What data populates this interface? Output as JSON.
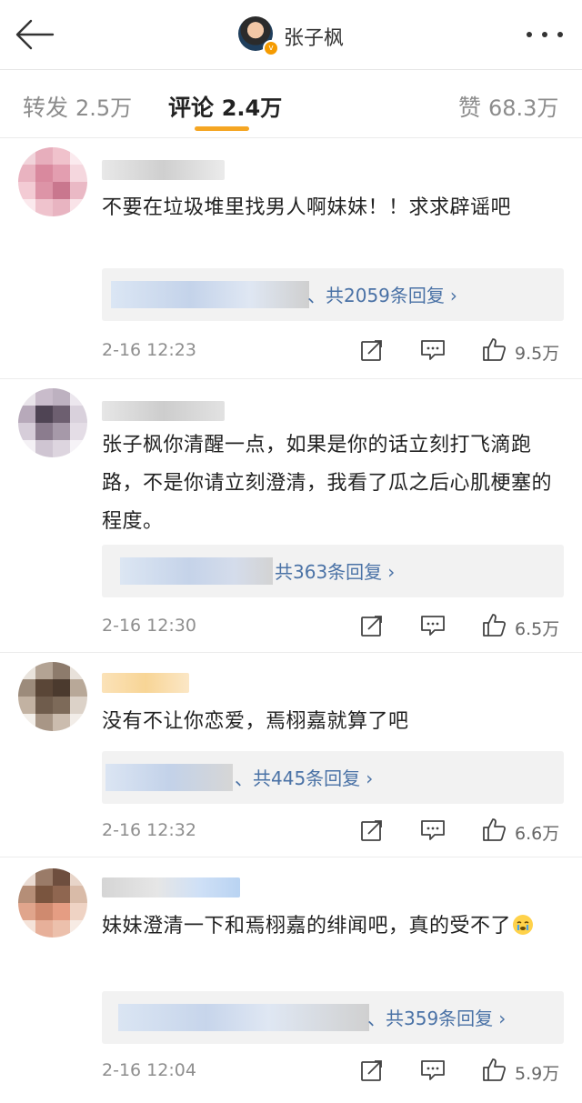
{
  "header": {
    "user_name": "张子枫",
    "verified_mark": "v"
  },
  "tabs": [
    {
      "label": "转发",
      "count": "2.5万"
    },
    {
      "label": "评论",
      "count": "2.4万"
    },
    {
      "label": "赞",
      "count": "68.3万"
    }
  ],
  "comments": [
    {
      "text": "不要在垃圾堆里找男人啊妹妹！！求求辟谣吧",
      "reply_summary": "、共2059条回复",
      "time": "2-16 12:23",
      "likes": "9.5万"
    },
    {
      "text": "张子枫你清醒一点，如果是你的话立刻打飞滴跑路，不是你请立刻澄清，我看了瓜之后心肌梗塞的程度。",
      "reply_summary": "共363条回复",
      "time": "2-16 12:30",
      "likes": "6.5万"
    },
    {
      "text": "没有不让你恋爱，焉栩嘉就算了吧",
      "reply_summary": "、共445条回复",
      "time": "2-16 12:32",
      "likes": "6.6万"
    },
    {
      "text": "妹妹澄清一下和焉栩嘉的绯闻吧，真的受不了",
      "emoji": "crying-emoji",
      "reply_summary": "、共359条回复",
      "time": "2-16 12:04",
      "likes": "5.9万"
    }
  ],
  "icons": {
    "back": "back-arrow-icon",
    "more": "more-dots-icon",
    "repost": "repost-icon",
    "comment": "comment-icon",
    "like": "like-icon",
    "reply_chevron": "chevron-right-icon"
  },
  "colors": {
    "accent": "#f5a623",
    "link": "#4a72a6",
    "verified": "#f59b00"
  }
}
